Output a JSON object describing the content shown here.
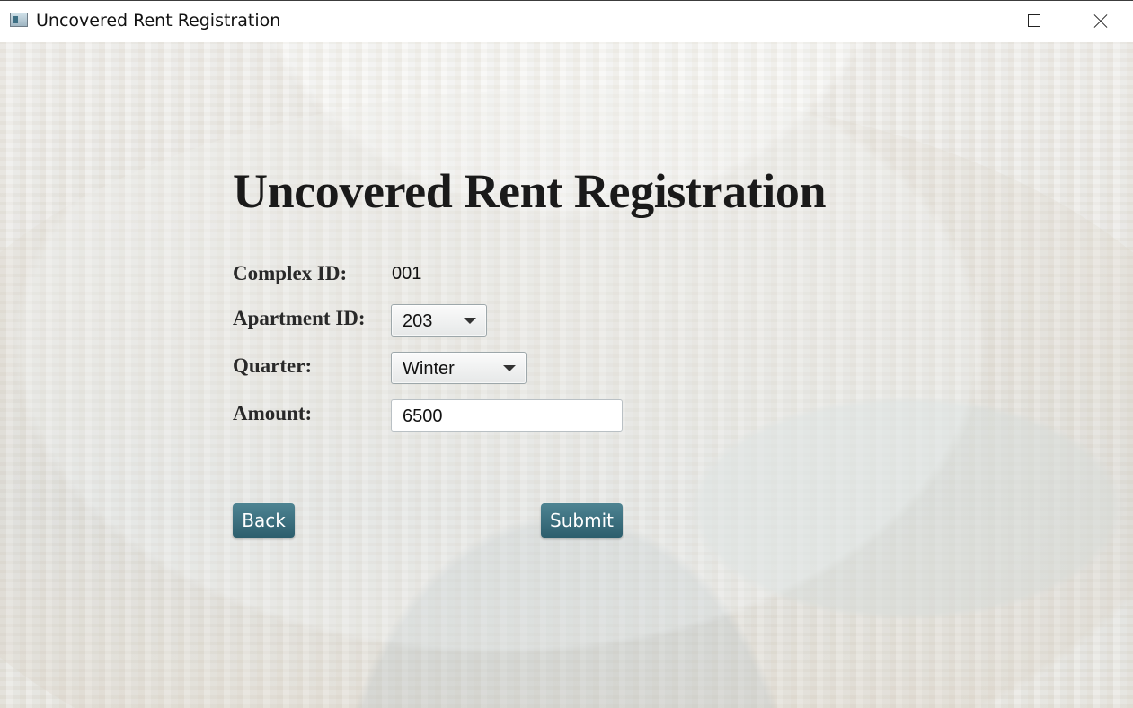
{
  "window": {
    "title": "Uncovered Rent Registration",
    "icon": "app-icon",
    "controls": [
      "minimize-icon",
      "maximize-icon",
      "close-icon"
    ]
  },
  "main": {
    "heading": "Uncovered Rent Registration",
    "fields": {
      "complex_id": {
        "label": "Complex ID:",
        "value": "001"
      },
      "apartment_id": {
        "label": "Apartment ID:",
        "selected": "203"
      },
      "quarter": {
        "label": "Quarter:",
        "selected": "Winter"
      },
      "amount": {
        "label": "Amount:",
        "value": "6500"
      }
    },
    "buttons": {
      "back": "Back",
      "submit": "Submit"
    }
  },
  "colors": {
    "accent_button": "#2f6472",
    "background_overlay": "#f1f1ef"
  }
}
